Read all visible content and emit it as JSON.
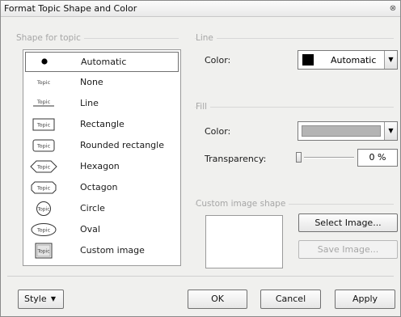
{
  "window": {
    "title": "Format Topic Shape and Color",
    "close_glyph": "⊗"
  },
  "shape_section": {
    "label": "Shape for topic",
    "items": [
      {
        "label": "Automatic",
        "icon": "bullet-dot-icon",
        "selected": true
      },
      {
        "label": "None",
        "icon": "topic-text-icon"
      },
      {
        "label": "Line",
        "icon": "topic-underline-icon"
      },
      {
        "label": "Rectangle",
        "icon": "topic-rectangle-icon"
      },
      {
        "label": "Rounded rectangle",
        "icon": "topic-rounded-rectangle-icon"
      },
      {
        "label": "Hexagon",
        "icon": "topic-hexagon-icon"
      },
      {
        "label": "Octagon",
        "icon": "topic-octagon-icon"
      },
      {
        "label": "Circle",
        "icon": "topic-circle-icon"
      },
      {
        "label": "Oval",
        "icon": "topic-oval-icon"
      },
      {
        "label": "Custom image",
        "icon": "topic-custom-image-icon"
      }
    ],
    "icon_text": "Topic"
  },
  "line_section": {
    "label": "Line",
    "color_label": "Color:",
    "color_value": "Automatic",
    "swatch_color": "#000000"
  },
  "fill_section": {
    "label": "Fill",
    "color_label": "Color:",
    "swatch_color": "#b4b4b4",
    "transparency_label": "Transparency:",
    "transparency_value": "0 %",
    "transparency_level": 0
  },
  "custom_image_section": {
    "label": "Custom image shape",
    "select_button": "Select Image...",
    "save_button": "Save Image..."
  },
  "footer": {
    "style_button": "Style",
    "ok_button": "OK",
    "cancel_button": "Cancel",
    "apply_button": "Apply"
  }
}
